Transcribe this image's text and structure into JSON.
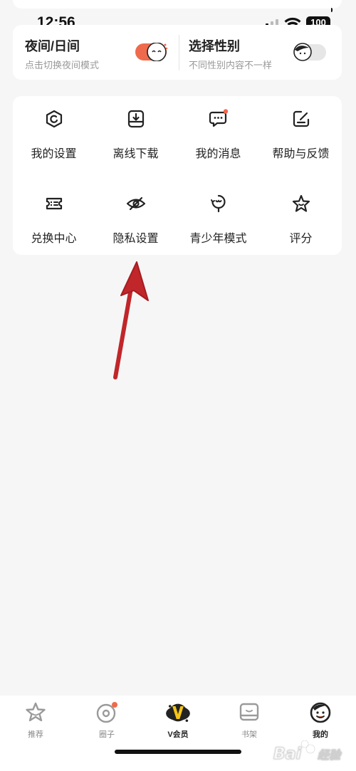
{
  "status_bar": {
    "time": "12:56",
    "battery": "100"
  },
  "toggles": [
    {
      "title": "夜间/日间",
      "subtitle": "点击切换夜间模式"
    },
    {
      "title": "选择性别",
      "subtitle": "不同性别内容不一样"
    }
  ],
  "menu": [
    {
      "label": "我的设置",
      "icon": "settings-icon"
    },
    {
      "label": "离线下载",
      "icon": "download-icon"
    },
    {
      "label": "我的消息",
      "icon": "message-icon"
    },
    {
      "label": "帮助与反馈",
      "icon": "feedback-icon"
    },
    {
      "label": "兑换中心",
      "icon": "ticket-icon"
    },
    {
      "label": "隐私设置",
      "icon": "privacy-eye-icon"
    },
    {
      "label": "青少年模式",
      "icon": "youth-mode-icon"
    },
    {
      "label": "评分",
      "icon": "star-icon"
    }
  ],
  "tabs": [
    {
      "label": "推荐",
      "icon": "star-tab-icon"
    },
    {
      "label": "圈子",
      "icon": "circle-tab-icon"
    },
    {
      "label": "V会员",
      "icon": "vip-tab-icon"
    },
    {
      "label": "书架",
      "icon": "bookshelf-tab-icon"
    },
    {
      "label": "我的",
      "icon": "profile-tab-icon"
    }
  ],
  "colors": {
    "accent": "#ef6a4c",
    "vip_yellow": "#f5c518",
    "arrow": "#c0262a"
  }
}
